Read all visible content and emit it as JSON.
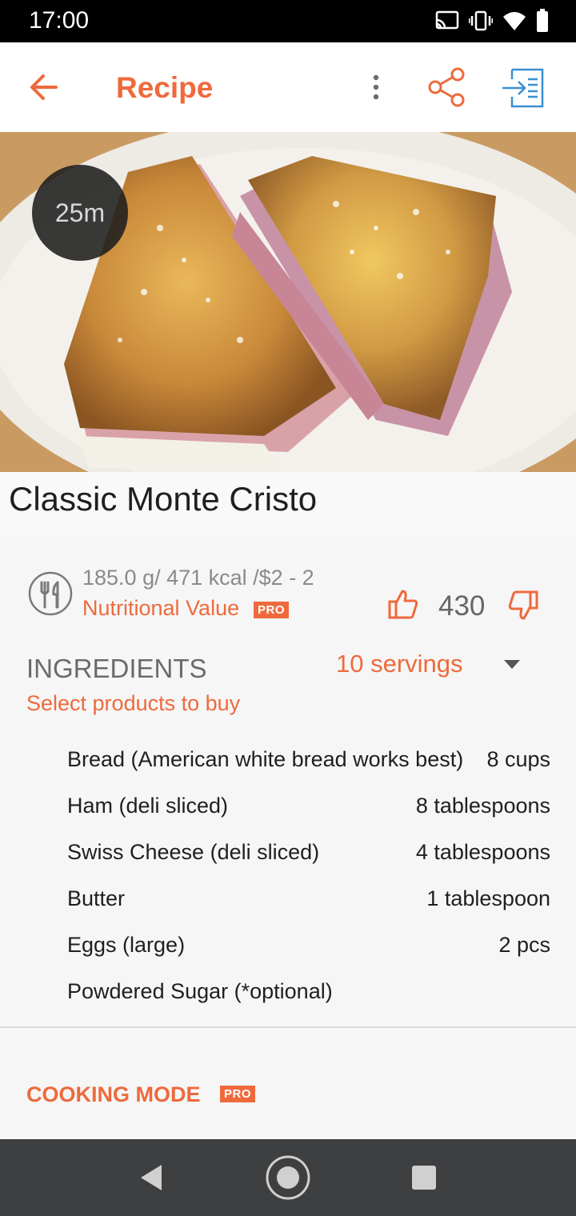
{
  "status_bar": {
    "time": "17:00",
    "icons": [
      "cast-icon",
      "vibrate-icon",
      "wifi-icon",
      "battery-icon"
    ]
  },
  "app_bar": {
    "title": "Recipe",
    "icons": [
      "back-arrow-icon",
      "more-vert-icon",
      "share-icon",
      "import-icon"
    ]
  },
  "recipe": {
    "time_badge": "25m",
    "title": "Classic Monte Cristo",
    "nutrition_summary": "185.0 g/ 471 kcal /$2 - 2",
    "nutrition_link": "Nutritional Value",
    "pro_label": "PRO",
    "likes": "430"
  },
  "ingredients": {
    "header": "INGREDIENTS",
    "servings": "10 servings",
    "buy_link": "Select products to buy",
    "items": [
      {
        "name": "Bread (American white bread works best)",
        "qty": "8 cups"
      },
      {
        "name": "Ham (deli sliced)",
        "qty": "8 tablespoons"
      },
      {
        "name": "Swiss Cheese (deli sliced)",
        "qty": "4 tablespoons"
      },
      {
        "name": "Butter",
        "qty": "1 tablespoon"
      },
      {
        "name": "Eggs (large)",
        "qty": "2 pcs"
      },
      {
        "name": "Powdered Sugar (*optional)",
        "qty": ""
      }
    ]
  },
  "cooking_mode": {
    "label": "COOKING MODE",
    "pro_label": "PRO"
  },
  "colors": {
    "accent": "#ee6a3c",
    "import_icon": "#3a8fd0",
    "nav_bar": "#3e3f41"
  }
}
